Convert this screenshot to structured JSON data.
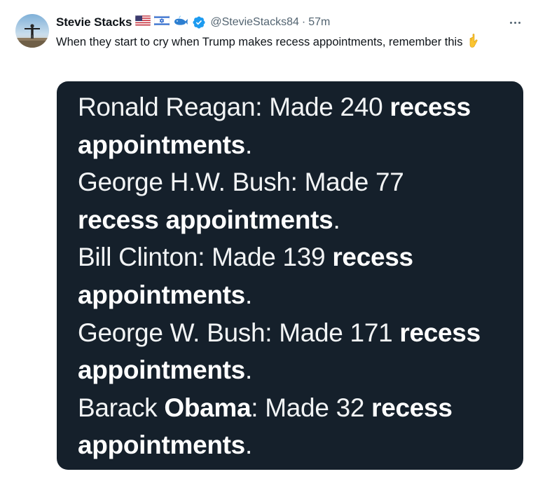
{
  "author": {
    "display_name": "Stevie Stacks",
    "handle": "@StevieStacks84",
    "separator": "·",
    "time": "57m",
    "badges": [
      "us-flag-icon",
      "israel-flag-icon",
      "whale-icon",
      "verified-badge-icon"
    ]
  },
  "tweet": {
    "text": "When they start to cry when Trump makes recess appointments, remember this",
    "emoji": "backhand-index-pointing-down-icon"
  },
  "media": {
    "background": "#15202b",
    "lines": [
      {
        "p1": "Ronald Reagan: Made 240 ",
        "b1": "recess",
        "p2": "",
        "b2": ""
      },
      {
        "p1": "",
        "b1": "appointments",
        "p2": ".",
        "b2": ""
      },
      {
        "p1": "George H.W. Bush: Made 77",
        "b1": "",
        "p2": "",
        "b2": ""
      },
      {
        "p1": "",
        "b1": "recess appointments",
        "p2": ".",
        "b2": ""
      },
      {
        "p1": "Bill Clinton: Made 139 ",
        "b1": "recess",
        "p2": "",
        "b2": ""
      },
      {
        "p1": "",
        "b1": "appointments",
        "p2": ".",
        "b2": ""
      },
      {
        "p1": "George W. Bush: Made 171 ",
        "b1": "recess",
        "p2": "",
        "b2": ""
      },
      {
        "p1": "",
        "b1": "appointments",
        "p2": ".",
        "b2": ""
      },
      {
        "p1": "Barack ",
        "b1": "Obama",
        "p2": ": Made 32 ",
        "b2": "recess"
      },
      {
        "p1": "",
        "b1": "appointments",
        "p2": ".",
        "b2": ""
      }
    ]
  },
  "colors": {
    "text": "#0f1419",
    "secondary": "#536471",
    "verified": "#1d9bf0",
    "media_text": "#f2f4f5"
  }
}
